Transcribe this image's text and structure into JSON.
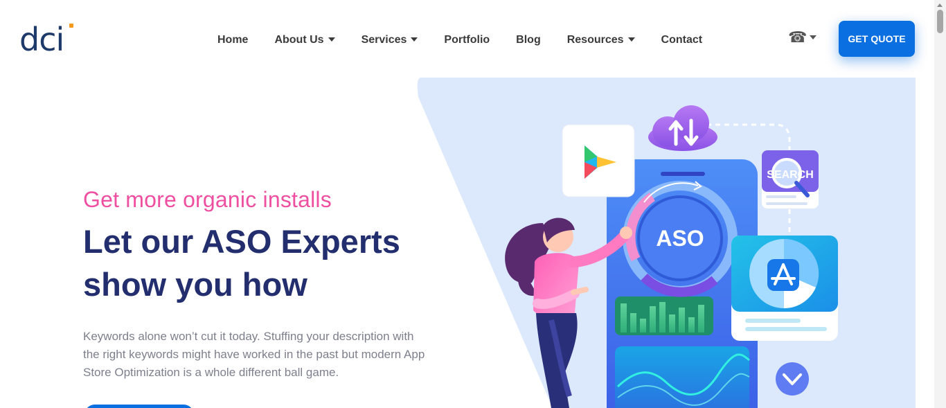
{
  "logo": {
    "text": "dci"
  },
  "nav": {
    "items": [
      {
        "label": "Home",
        "dropdown": false
      },
      {
        "label": "About Us",
        "dropdown": true
      },
      {
        "label": "Services",
        "dropdown": true
      },
      {
        "label": "Portfolio",
        "dropdown": false
      },
      {
        "label": "Blog",
        "dropdown": false
      },
      {
        "label": "Resources",
        "dropdown": true
      },
      {
        "label": "Contact",
        "dropdown": false
      }
    ]
  },
  "phone": {
    "icon": "phone-icon",
    "glyph": "☎"
  },
  "quote_button": {
    "label": "GET QUOTE",
    "color": "#0a6fe0"
  },
  "hero": {
    "tagline": "Get more organic installs",
    "headline": "Let our ASO Experts show you how",
    "description": "Keywords alone won’t cut it today. Stuffing your description with the right keywords might have worked in the past but modern App Store Optimization is a whole different ball game."
  },
  "illustration": {
    "center_label": "ASO",
    "search_label": "SEARCH"
  },
  "colors": {
    "accent": "#0a6fe0",
    "tagline": "#ef4fa0",
    "headline": "#232e6e",
    "body": "#7d7f8c",
    "logo": "#1e3a6b",
    "logo_dot": "#f39a1e",
    "art_background": "#dce9fd"
  }
}
